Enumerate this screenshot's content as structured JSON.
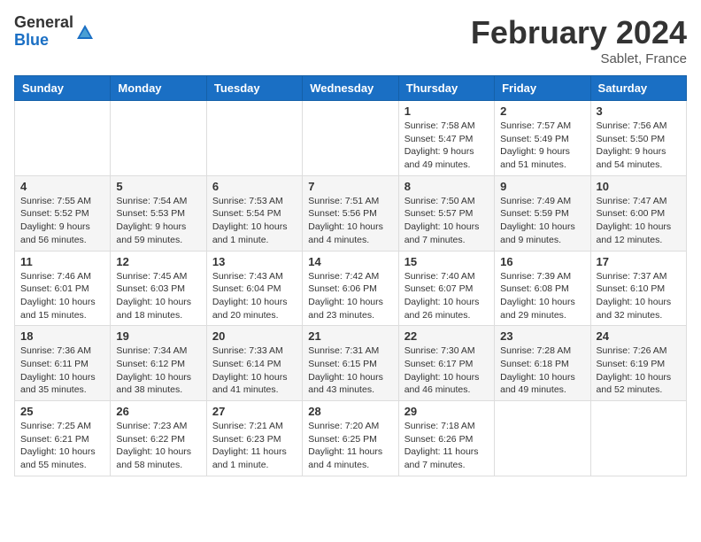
{
  "logo": {
    "general": "General",
    "blue": "Blue"
  },
  "title": "February 2024",
  "location": "Sablet, France",
  "days_header": [
    "Sunday",
    "Monday",
    "Tuesday",
    "Wednesday",
    "Thursday",
    "Friday",
    "Saturday"
  ],
  "weeks": [
    [
      {
        "day": "",
        "info": ""
      },
      {
        "day": "",
        "info": ""
      },
      {
        "day": "",
        "info": ""
      },
      {
        "day": "",
        "info": ""
      },
      {
        "day": "1",
        "info": "Sunrise: 7:58 AM\nSunset: 5:47 PM\nDaylight: 9 hours\nand 49 minutes."
      },
      {
        "day": "2",
        "info": "Sunrise: 7:57 AM\nSunset: 5:49 PM\nDaylight: 9 hours\nand 51 minutes."
      },
      {
        "day": "3",
        "info": "Sunrise: 7:56 AM\nSunset: 5:50 PM\nDaylight: 9 hours\nand 54 minutes."
      }
    ],
    [
      {
        "day": "4",
        "info": "Sunrise: 7:55 AM\nSunset: 5:52 PM\nDaylight: 9 hours\nand 56 minutes."
      },
      {
        "day": "5",
        "info": "Sunrise: 7:54 AM\nSunset: 5:53 PM\nDaylight: 9 hours\nand 59 minutes."
      },
      {
        "day": "6",
        "info": "Sunrise: 7:53 AM\nSunset: 5:54 PM\nDaylight: 10 hours\nand 1 minute."
      },
      {
        "day": "7",
        "info": "Sunrise: 7:51 AM\nSunset: 5:56 PM\nDaylight: 10 hours\nand 4 minutes."
      },
      {
        "day": "8",
        "info": "Sunrise: 7:50 AM\nSunset: 5:57 PM\nDaylight: 10 hours\nand 7 minutes."
      },
      {
        "day": "9",
        "info": "Sunrise: 7:49 AM\nSunset: 5:59 PM\nDaylight: 10 hours\nand 9 minutes."
      },
      {
        "day": "10",
        "info": "Sunrise: 7:47 AM\nSunset: 6:00 PM\nDaylight: 10 hours\nand 12 minutes."
      }
    ],
    [
      {
        "day": "11",
        "info": "Sunrise: 7:46 AM\nSunset: 6:01 PM\nDaylight: 10 hours\nand 15 minutes."
      },
      {
        "day": "12",
        "info": "Sunrise: 7:45 AM\nSunset: 6:03 PM\nDaylight: 10 hours\nand 18 minutes."
      },
      {
        "day": "13",
        "info": "Sunrise: 7:43 AM\nSunset: 6:04 PM\nDaylight: 10 hours\nand 20 minutes."
      },
      {
        "day": "14",
        "info": "Sunrise: 7:42 AM\nSunset: 6:06 PM\nDaylight: 10 hours\nand 23 minutes."
      },
      {
        "day": "15",
        "info": "Sunrise: 7:40 AM\nSunset: 6:07 PM\nDaylight: 10 hours\nand 26 minutes."
      },
      {
        "day": "16",
        "info": "Sunrise: 7:39 AM\nSunset: 6:08 PM\nDaylight: 10 hours\nand 29 minutes."
      },
      {
        "day": "17",
        "info": "Sunrise: 7:37 AM\nSunset: 6:10 PM\nDaylight: 10 hours\nand 32 minutes."
      }
    ],
    [
      {
        "day": "18",
        "info": "Sunrise: 7:36 AM\nSunset: 6:11 PM\nDaylight: 10 hours\nand 35 minutes."
      },
      {
        "day": "19",
        "info": "Sunrise: 7:34 AM\nSunset: 6:12 PM\nDaylight: 10 hours\nand 38 minutes."
      },
      {
        "day": "20",
        "info": "Sunrise: 7:33 AM\nSunset: 6:14 PM\nDaylight: 10 hours\nand 41 minutes."
      },
      {
        "day": "21",
        "info": "Sunrise: 7:31 AM\nSunset: 6:15 PM\nDaylight: 10 hours\nand 43 minutes."
      },
      {
        "day": "22",
        "info": "Sunrise: 7:30 AM\nSunset: 6:17 PM\nDaylight: 10 hours\nand 46 minutes."
      },
      {
        "day": "23",
        "info": "Sunrise: 7:28 AM\nSunset: 6:18 PM\nDaylight: 10 hours\nand 49 minutes."
      },
      {
        "day": "24",
        "info": "Sunrise: 7:26 AM\nSunset: 6:19 PM\nDaylight: 10 hours\nand 52 minutes."
      }
    ],
    [
      {
        "day": "25",
        "info": "Sunrise: 7:25 AM\nSunset: 6:21 PM\nDaylight: 10 hours\nand 55 minutes."
      },
      {
        "day": "26",
        "info": "Sunrise: 7:23 AM\nSunset: 6:22 PM\nDaylight: 10 hours\nand 58 minutes."
      },
      {
        "day": "27",
        "info": "Sunrise: 7:21 AM\nSunset: 6:23 PM\nDaylight: 11 hours\nand 1 minute."
      },
      {
        "day": "28",
        "info": "Sunrise: 7:20 AM\nSunset: 6:25 PM\nDaylight: 11 hours\nand 4 minutes."
      },
      {
        "day": "29",
        "info": "Sunrise: 7:18 AM\nSunset: 6:26 PM\nDaylight: 11 hours\nand 7 minutes."
      },
      {
        "day": "",
        "info": ""
      },
      {
        "day": "",
        "info": ""
      }
    ]
  ]
}
